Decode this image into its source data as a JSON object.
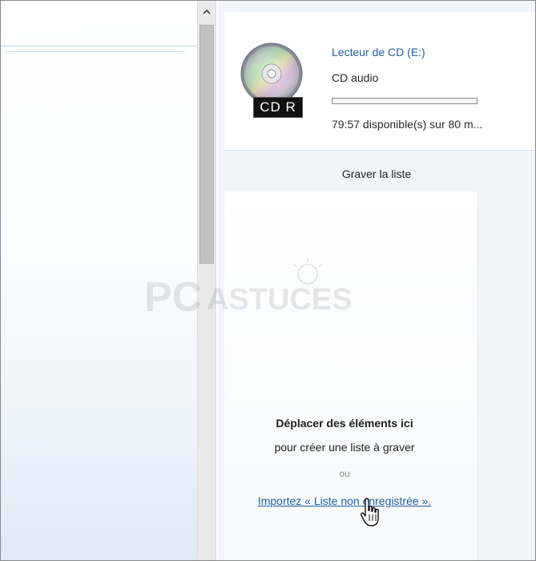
{
  "scrollbar": {
    "up_icon": "chevron-up-icon"
  },
  "device": {
    "icon": "cd-disc-icon",
    "disc_label": "CD R",
    "name": "Lecteur de CD (E:)",
    "type": "CD audio",
    "usage_fraction": 0.0,
    "free_text": "79:57 disponible(s) sur 80 m..."
  },
  "burn_list": {
    "title": "Graver la liste",
    "empty_title": "Déplacer des éléments ici",
    "empty_subtitle": "pour créer une liste à graver",
    "or_text": "ou",
    "import_link": "Importez « Liste non enregistrée »."
  },
  "watermark": {
    "text": "PCASTUCES"
  },
  "colors": {
    "link": "#1f5fa6",
    "pane_background": "#f2f6fa",
    "scroll_thumb": "#c2c2c2"
  }
}
